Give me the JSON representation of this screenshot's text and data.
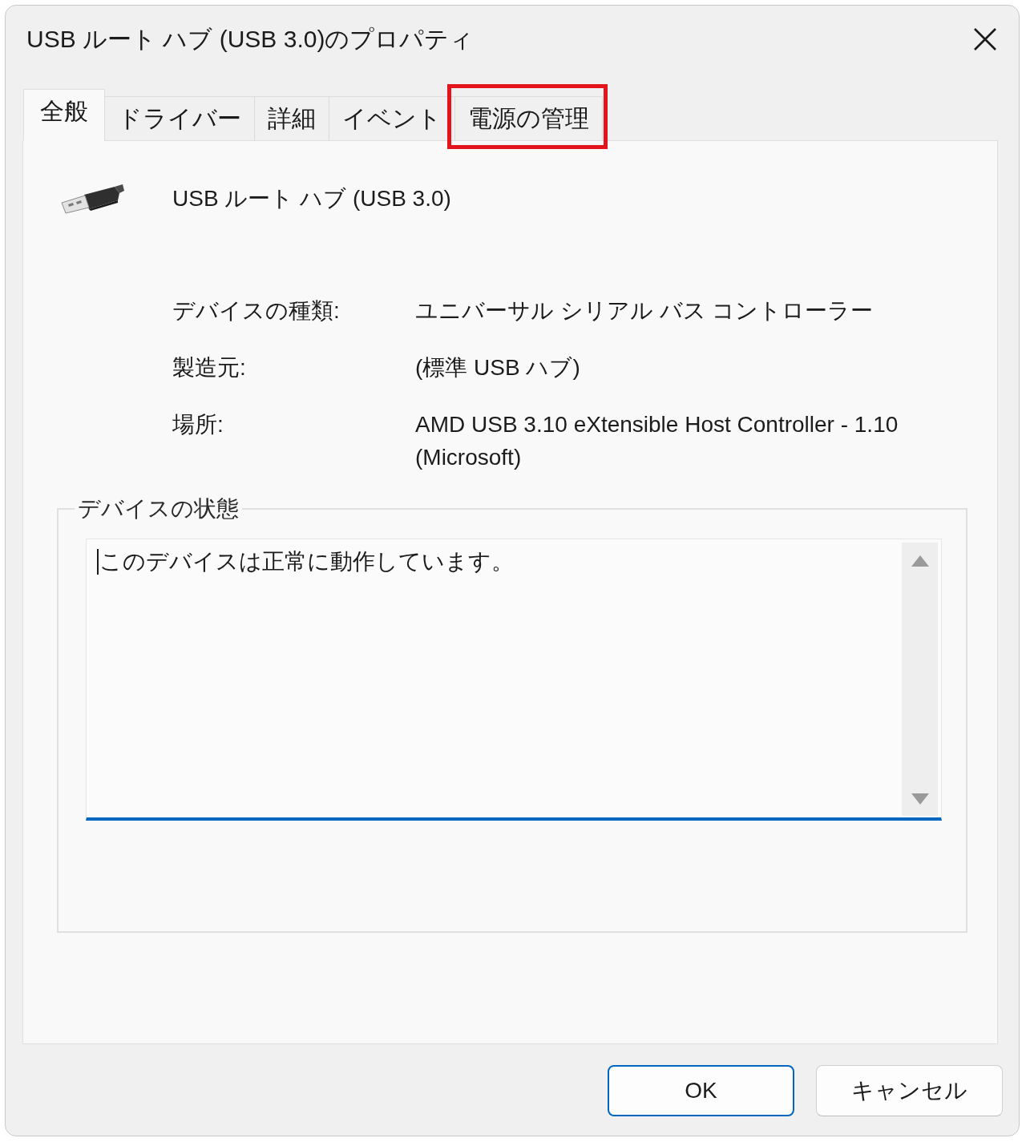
{
  "window": {
    "title": "USB ルート ハブ (USB 3.0)のプロパティ"
  },
  "tabs": [
    {
      "label": "全般",
      "selected": true,
      "highlighted": false
    },
    {
      "label": "ドライバー",
      "selected": false,
      "highlighted": false
    },
    {
      "label": "詳細",
      "selected": false,
      "highlighted": false
    },
    {
      "label": "イベント",
      "selected": false,
      "highlighted": false
    },
    {
      "label": "電源の管理",
      "selected": false,
      "highlighted": true
    }
  ],
  "device": {
    "name": "USB ルート ハブ (USB 3.0)"
  },
  "properties": [
    {
      "label": "デバイスの種類:",
      "value": "ユニバーサル シリアル バス コントローラー"
    },
    {
      "label": "製造元:",
      "value": "(標準 USB ハブ)"
    },
    {
      "label": "場所:",
      "value": "AMD USB 3.10 eXtensible Host Controller - 1.10 (Microsoft)"
    }
  ],
  "status_group": {
    "title": "デバイスの状態",
    "text": "このデバイスは正常に動作しています。",
    "focused": true
  },
  "buttons": [
    {
      "label": "OK",
      "default": true
    },
    {
      "label": "キャンセル",
      "default": false
    }
  ]
}
